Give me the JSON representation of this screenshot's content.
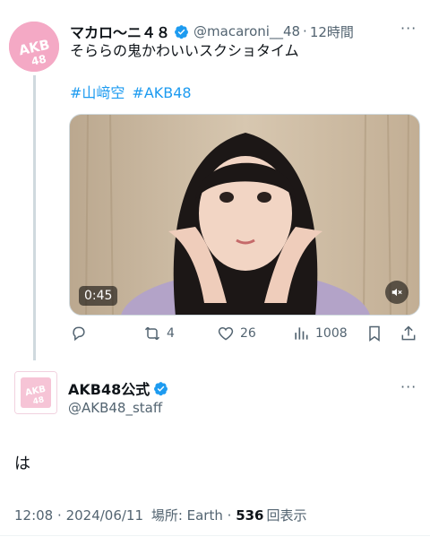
{
  "quoted_tweet": {
    "display_name": "マカロ〜ニ４８",
    "handle": "@macaroni__48",
    "separator": "·",
    "time": "12時間",
    "text": "そららの鬼かわいいスクショタイム",
    "hashtags": [
      "#山﨑空",
      "#AKB48"
    ],
    "video_duration": "0:45",
    "actions": {
      "retweets": "4",
      "likes": "26",
      "views": "1008"
    }
  },
  "main_tweet": {
    "display_name": "AKB48公式",
    "handle": "@AKB48_staff",
    "text": "は",
    "footer": {
      "time": "12:08",
      "date": "2024/06/11",
      "location_label": "場所: Earth",
      "views_count": "536",
      "views_label": "回表示"
    }
  },
  "avatar_logo_text": "AKB48",
  "colors": {
    "accent": "#1d9bf0",
    "secondary_text": "#536471",
    "avatar_pink": "#f4a9c5"
  },
  "icons": [
    "verified-badge-icon",
    "reply-icon",
    "retweet-icon",
    "like-icon",
    "views-icon",
    "bookmark-icon",
    "share-icon",
    "mute-icon",
    "more-icon"
  ]
}
